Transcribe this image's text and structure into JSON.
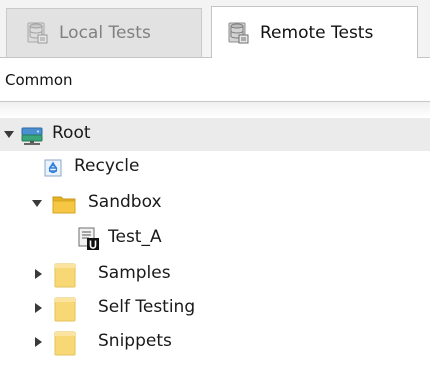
{
  "tabs": [
    {
      "label": "Local Tests",
      "active": false,
      "icon": "database-icon"
    },
    {
      "label": "Remote Tests",
      "active": true,
      "icon": "database-icon"
    }
  ],
  "selector": {
    "value": "Common"
  },
  "tree": {
    "root": {
      "label": "Root",
      "icon": "server-icon",
      "expanded": true
    },
    "recycle": {
      "label": "Recycle",
      "icon": "recycle-bin-icon"
    },
    "sandbox": {
      "label": "Sandbox",
      "icon": "folder-icon",
      "expanded": true
    },
    "test_a": {
      "label": "Test_A",
      "icon": "test-script-icon"
    },
    "samples": {
      "label": "Samples",
      "icon": "folder-icon",
      "expanded": false
    },
    "self_testing": {
      "label": "Self Testing",
      "icon": "folder-icon",
      "expanded": false
    },
    "snippets": {
      "label": "Snippets",
      "icon": "folder-icon",
      "expanded": false
    }
  },
  "colors": {
    "folder_yellow": "#f8d775",
    "folder_open_yellow": "#f0c419",
    "server_blue": "#3f7fbf",
    "server_green": "#2e9e6e",
    "selected_row": "#ebebeb"
  }
}
